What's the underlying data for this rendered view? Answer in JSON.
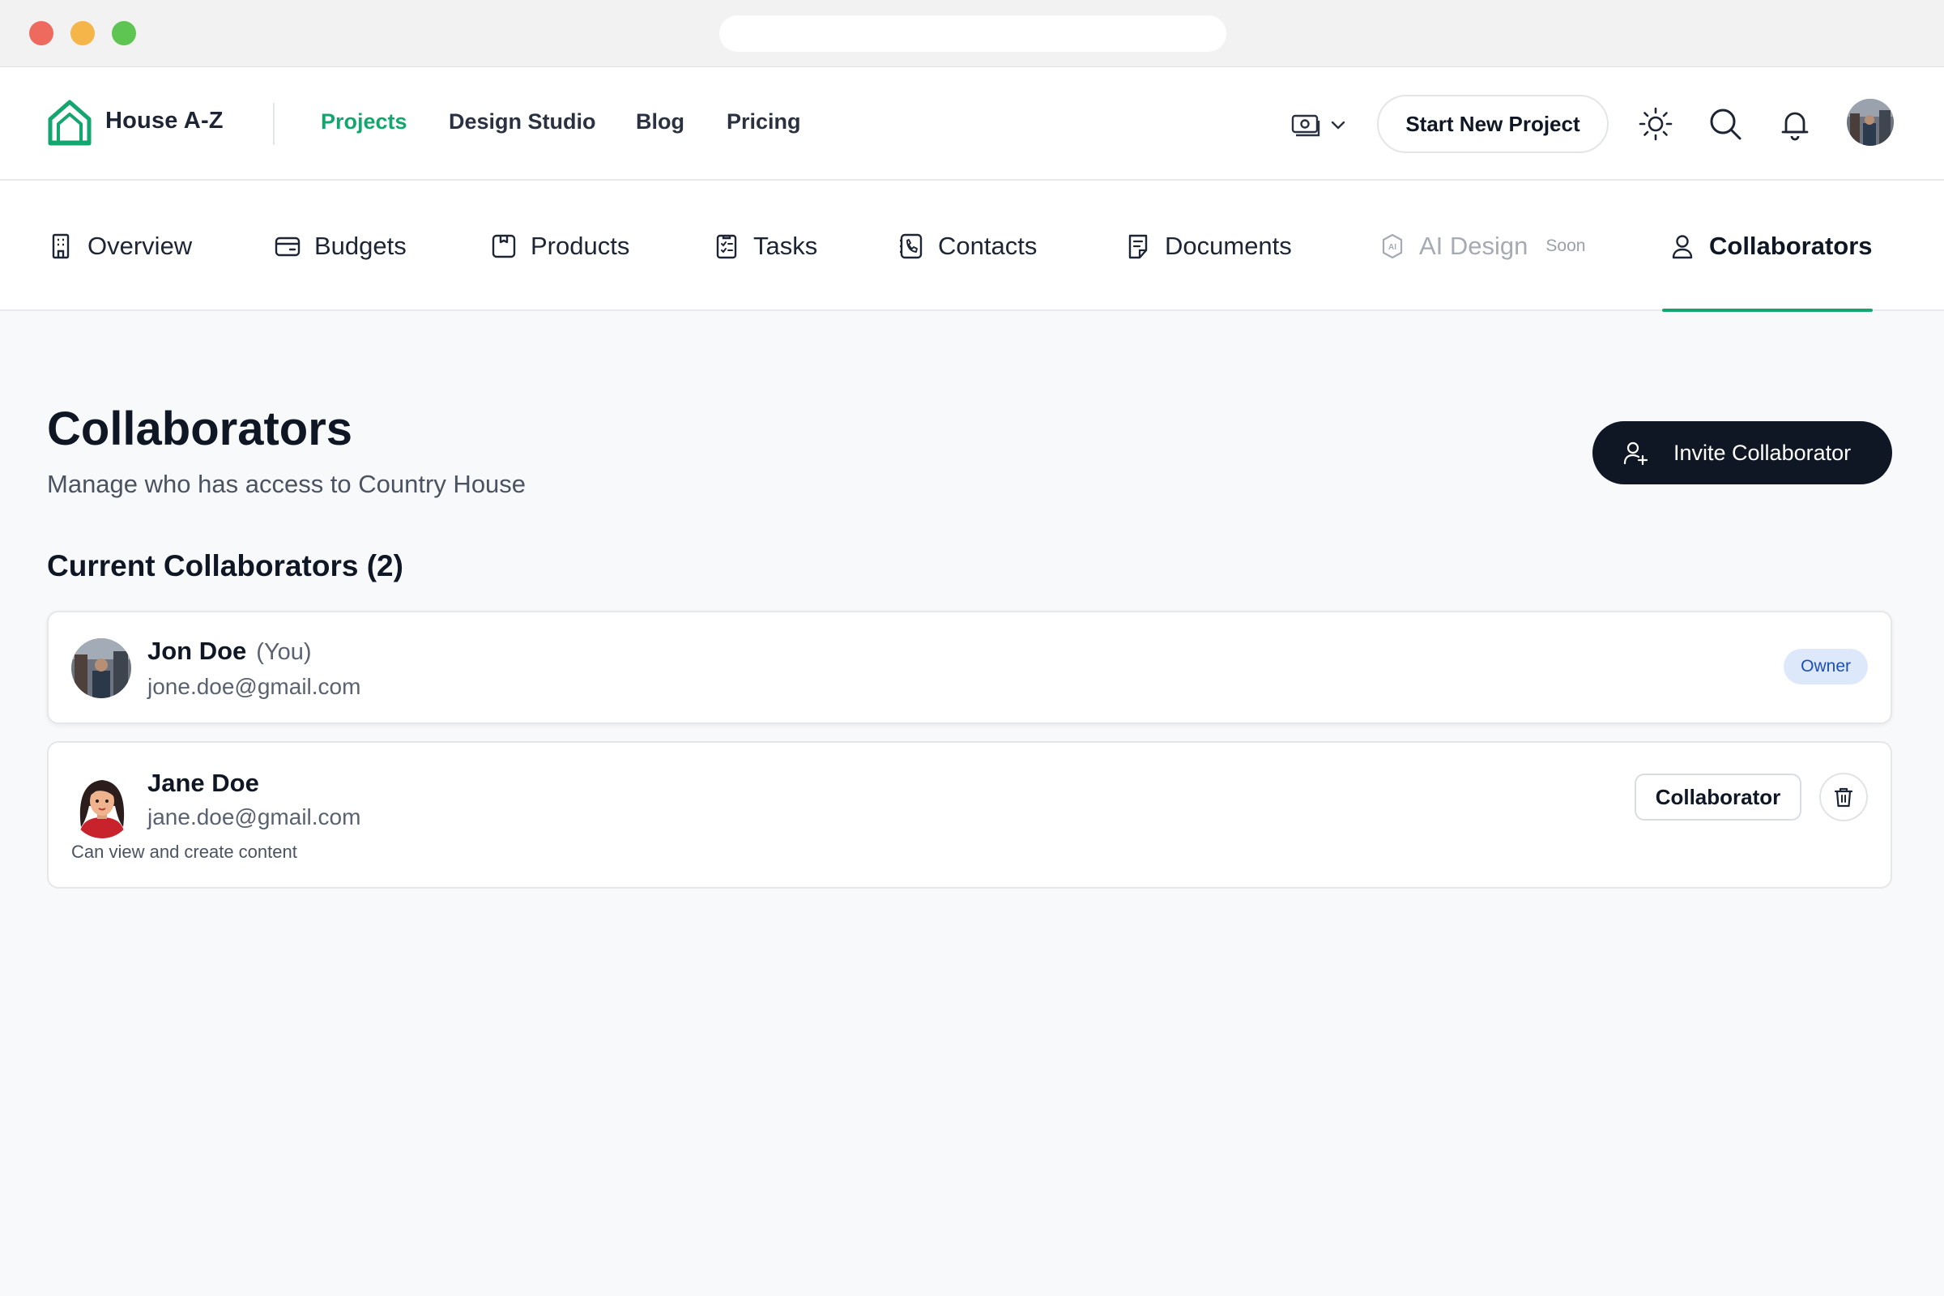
{
  "brand": {
    "name": "House A-Z",
    "accent": "#14a66f"
  },
  "nav": {
    "links": [
      "Projects",
      "Design Studio",
      "Blog",
      "Pricing"
    ],
    "active": "Projects",
    "start_project": "Start New Project"
  },
  "tabs": {
    "items": [
      {
        "label": "Overview",
        "icon": "building-icon"
      },
      {
        "label": "Budgets",
        "icon": "wallet-icon"
      },
      {
        "label": "Products",
        "icon": "package-icon"
      },
      {
        "label": "Tasks",
        "icon": "clipboard-list-icon"
      },
      {
        "label": "Contacts",
        "icon": "phone-book-icon"
      },
      {
        "label": "Documents",
        "icon": "document-icon"
      },
      {
        "label": "AI Design",
        "icon": "ai-chip-icon",
        "badge": "Soon",
        "disabled": true
      },
      {
        "label": "Collaborators",
        "icon": "user-icon",
        "active": true
      }
    ]
  },
  "page": {
    "title": "Collaborators",
    "subtitle": "Manage who has access to Country House",
    "invite_button": "Invite Collaborator",
    "section_title": "Current Collaborators (2)"
  },
  "collaborators": [
    {
      "name": "Jon Doe",
      "tag": "(You)",
      "email": "jone.doe@gmail.com",
      "role": "Owner"
    },
    {
      "name": "Jane Doe",
      "email": "jane.doe@gmail.com",
      "role": "Collaborator",
      "permission": "Can view and create content"
    }
  ]
}
